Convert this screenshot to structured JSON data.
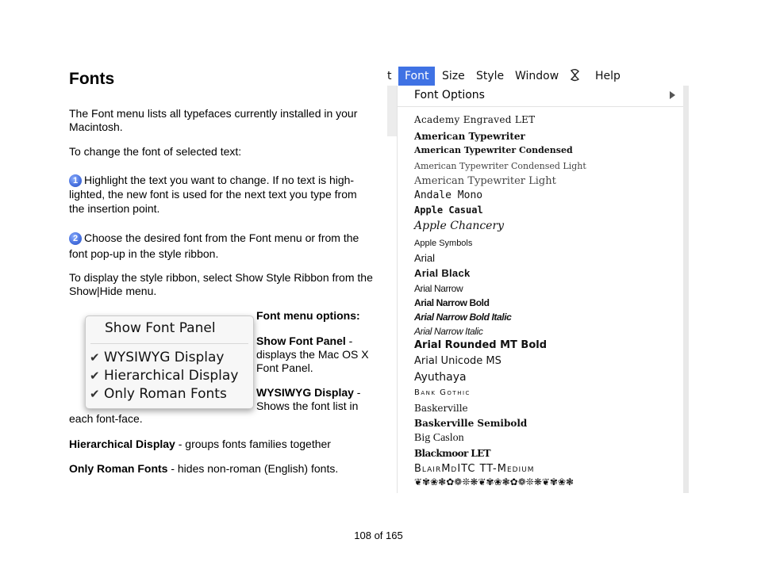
{
  "page": {
    "title": "Fonts",
    "intro": "The Font menu lists all typefaces currently installed in your Macintosh.",
    "change_intro": "To change the font of selected text:",
    "steps": [
      {
        "badge": "1",
        "text_line1": "Highlight the text you want to change. If no text is high-",
        "text_rest": "lighted, the new font is used for the next text you type from the insertion point."
      },
      {
        "badge": "2",
        "text_line1": "Choose the desired font from the Font menu or from the",
        "text_rest": "font pop-up in the style ribbon."
      }
    ],
    "ribbon_note": "To display the style ribbon, select Show Style Ribbon from the Show|Hide menu.",
    "options_heading": "Font menu options:",
    "options": [
      {
        "name": "Show Font Panel",
        "desc": " - displays the Mac OS X Font Panel."
      },
      {
        "name": "WYSIWYG Display",
        "desc": " - Shows the font list in"
      }
    ],
    "wysiwyg_cont": "each font-face.",
    "hier": {
      "name": "Hierarchical Display",
      "desc": " - groups fonts families together"
    },
    "roman": {
      "name": "Only Roman Fonts",
      "desc": " - hides non-roman (English) fonts."
    },
    "footer": "108 of 165"
  },
  "popup": {
    "show_font_panel": "Show Font Panel",
    "check_glyph": "✔",
    "items": [
      "WYSIWYG Display",
      "Hierarchical Display",
      "Only Roman Fonts"
    ]
  },
  "menubar": {
    "cut_prefix": "t",
    "active": "Font",
    "items": [
      "Size",
      "Style",
      "Window",
      "Help"
    ],
    "script_icon": "script-icon"
  },
  "font_menu": {
    "options_label": "Font Options",
    "fonts": [
      "Academy Engraved LET",
      "American Typewriter",
      "American Typewriter Condensed",
      "American Typewriter Condensed Light",
      "American Typewriter Light",
      "Andale Mono",
      "Apple Casual",
      "Apple Chancery",
      "Apple Symbols",
      "Arial",
      "Arial Black",
      "Arial Narrow",
      "Arial Narrow Bold",
      "Arial Narrow Bold Italic",
      "Arial Narrow Italic",
      "Arial Rounded MT Bold",
      "Arial Unicode MS",
      "Ayuthaya",
      "Bank Gothic",
      "Baskerville",
      "Baskerville Semibold",
      "Big Caslon",
      "Blackmoor LET",
      "BlairMdITC TT-Medium",
      "❦✾❀❃✿❁❊❋❦✾❀❃✿❁❊❋❦✾❀❃"
    ]
  }
}
